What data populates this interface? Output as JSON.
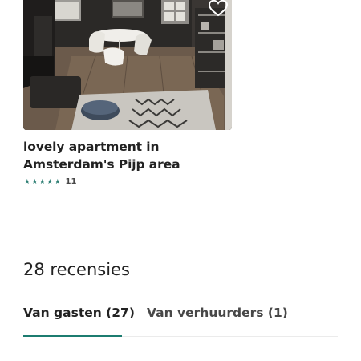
{
  "listing": {
    "title_line1": "lovely apartment in",
    "title_line2": "Amsterdam's Pijp area",
    "rating_stars": 5,
    "rating_count": "11",
    "photo_icon": "heart-icon"
  },
  "reviews": {
    "heading": "28 recensies",
    "tabs": [
      {
        "label": "Van gasten (27)",
        "active": true
      },
      {
        "label": "Van verhuurders (1)",
        "active": false
      }
    ]
  },
  "colors": {
    "accent": "#1c7c70",
    "star": "#2e7f74",
    "text": "#222222",
    "divider": "#ebebeb"
  }
}
